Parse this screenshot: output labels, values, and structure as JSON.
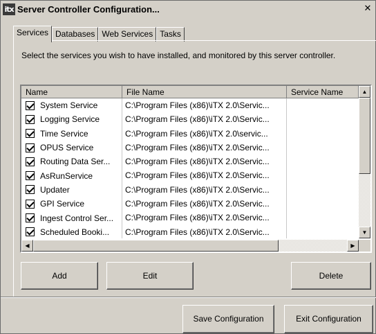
{
  "window": {
    "icon_text": "itx",
    "title": "Server Controller Configuration...",
    "close_glyph": "✕"
  },
  "tabs": [
    {
      "label": "Services",
      "active": true
    },
    {
      "label": "Databases",
      "active": false
    },
    {
      "label": "Web Services",
      "active": false
    },
    {
      "label": "Tasks",
      "active": false
    }
  ],
  "services_tab": {
    "description": "Select the services you wish to have installed, and monitored by this server controller.",
    "columns": [
      "Name",
      "File Name",
      "Service Name"
    ],
    "rows": [
      {
        "name": "System Service",
        "file": "C:\\Program Files (x86)\\iTX 2.0\\Servic...",
        "service": "",
        "checked": true
      },
      {
        "name": "Logging Service",
        "file": "C:\\Program Files (x86)\\iTX 2.0\\Servic...",
        "service": "",
        "checked": true
      },
      {
        "name": "Time Service",
        "file": "C:\\Program Files (x86)\\iTX 2.0\\servic...",
        "service": "",
        "checked": true
      },
      {
        "name": "OPUS Service",
        "file": "C:\\Program Files (x86)\\iTX 2.0\\Servic...",
        "service": "",
        "checked": true
      },
      {
        "name": "Routing Data Ser...",
        "file": "C:\\Program Files (x86)\\iTX 2.0\\Servic...",
        "service": "",
        "checked": true
      },
      {
        "name": "AsRunService",
        "file": "C:\\Program Files (x86)\\iTX 2.0\\Servic...",
        "service": "",
        "checked": true
      },
      {
        "name": "Updater",
        "file": "C:\\Program Files (x86)\\iTX 2.0\\Servic...",
        "service": "",
        "checked": true
      },
      {
        "name": "GPI Service",
        "file": "C:\\Program Files (x86)\\iTX 2.0\\Servic...",
        "service": "",
        "checked": true
      },
      {
        "name": "Ingest Control Ser...",
        "file": "C:\\Program Files (x86)\\iTX 2.0\\Servic...",
        "service": "",
        "checked": true
      },
      {
        "name": "Scheduled Booki...",
        "file": "C:\\Program Files (x86)\\iTX 2.0\\Servic...",
        "service": "",
        "checked": true
      }
    ],
    "buttons": {
      "add": "Add",
      "edit": "Edit",
      "delete": "Delete"
    }
  },
  "footer": {
    "save": "Save Configuration",
    "exit": "Exit Configuration"
  },
  "scroll_glyphs": {
    "up": "▲",
    "down": "▼",
    "left": "◀",
    "right": "▶"
  },
  "colors": {
    "face": "#d4d0c8",
    "window": "#ffffff"
  }
}
